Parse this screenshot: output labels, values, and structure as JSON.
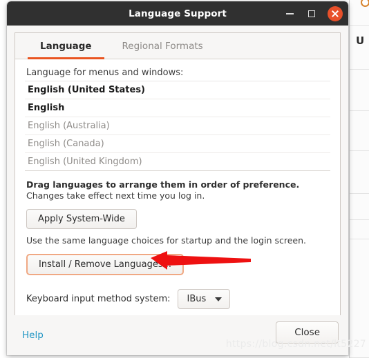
{
  "window": {
    "title": "Language Support",
    "controls": {
      "minimize": "Minimize",
      "maximize": "Maximize",
      "close": "Close"
    }
  },
  "tabs": [
    {
      "label": "Language",
      "active": true
    },
    {
      "label": "Regional Formats",
      "active": false
    }
  ],
  "language_tab": {
    "list_label": "Language for menus and windows:",
    "languages": [
      {
        "name": "English (United States)",
        "enabled": true
      },
      {
        "name": "English",
        "enabled": true
      },
      {
        "name": "English (Australia)",
        "enabled": false
      },
      {
        "name": "English (Canada)",
        "enabled": false
      },
      {
        "name": "English (United Kingdom)",
        "enabled": false
      }
    ],
    "hint_bold": "Drag languages to arrange them in order of preference.",
    "hint_normal": "Changes take effect next time you log in.",
    "apply_button": "Apply System-Wide",
    "apply_explanation": "Use the same language choices for startup and the login screen.",
    "install_button": "Install / Remove Languages...",
    "keyboard_label": "Keyboard input method system:",
    "keyboard_value": "IBus"
  },
  "footer": {
    "help": "Help",
    "close": "Close"
  },
  "annotation": {
    "arrow_color": "#ee1111",
    "target": "install-remove-languages-button"
  },
  "watermark": "https://blog.csdn.net/lt5227",
  "colors": {
    "accent": "#e95420",
    "titlebar": "#303030",
    "close_button": "#e8502a",
    "link": "#2196c4",
    "focus_border": "#f0a883"
  },
  "background_window": {
    "letter": "U"
  }
}
